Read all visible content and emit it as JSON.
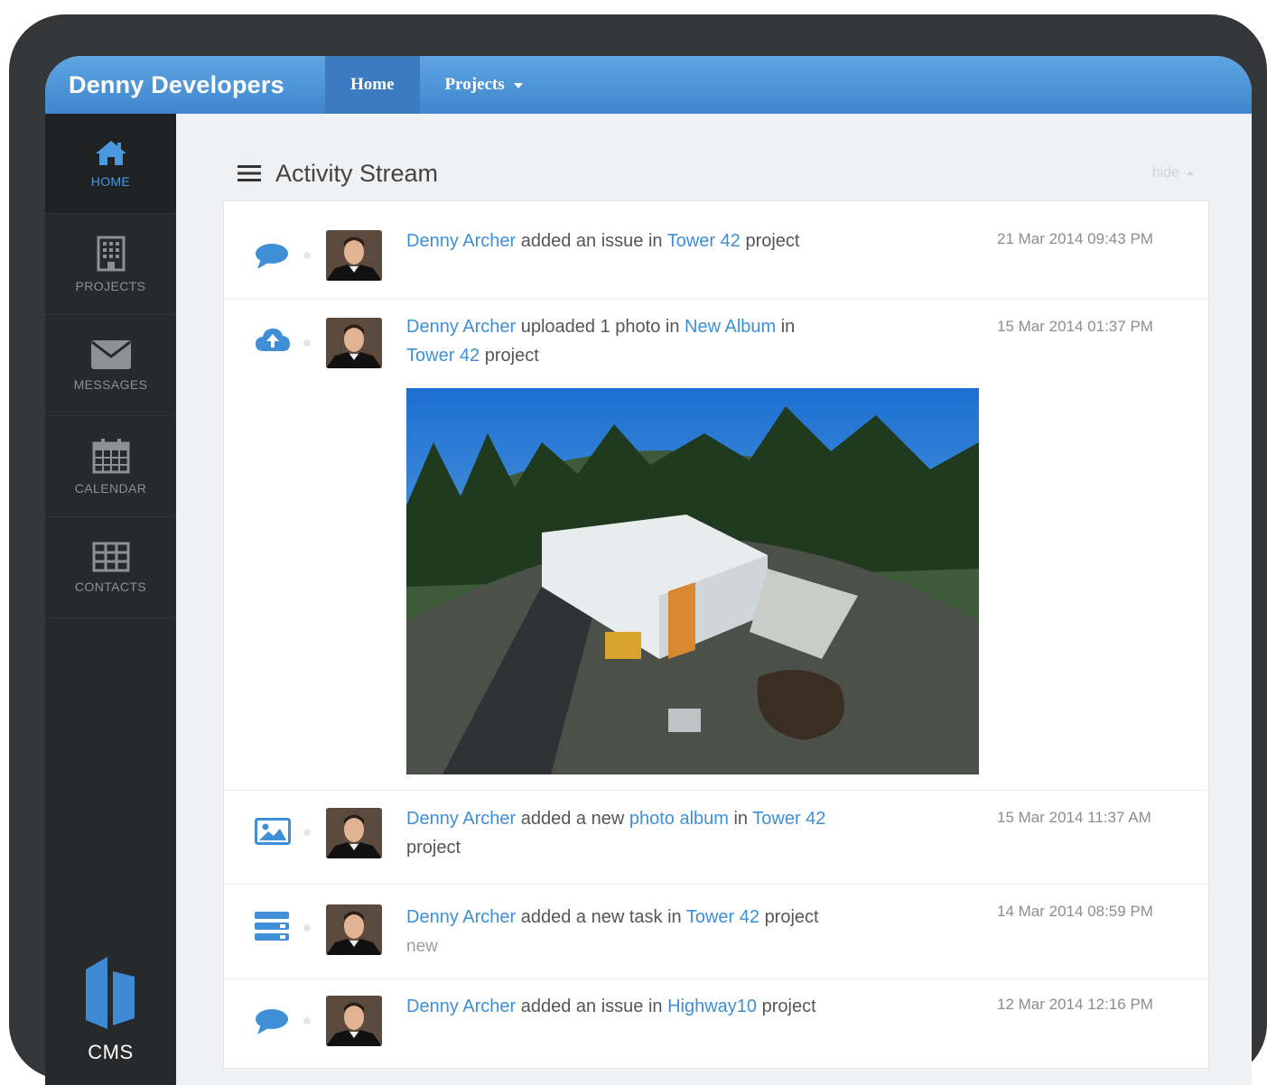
{
  "brand": "Denny Developers",
  "nav": {
    "home": "Home",
    "projects": "Projects"
  },
  "sidebar": {
    "items": [
      {
        "label": "HOME",
        "icon": "home-icon"
      },
      {
        "label": "PROJECTS",
        "icon": "building-icon"
      },
      {
        "label": "MESSAGES",
        "icon": "envelope-icon"
      },
      {
        "label": "CALENDAR",
        "icon": "calendar-icon"
      },
      {
        "label": "CONTACTS",
        "icon": "grid-icon"
      }
    ],
    "logo_label": "CMS"
  },
  "stream": {
    "title": "Activity Stream",
    "hide_label": "hide",
    "entries": [
      {
        "icon": "comment-icon",
        "user": "Denny Archer",
        "verb": "added an issue in",
        "target": "Tower 42",
        "suffix": "project",
        "time": "21 Mar 2014 09:43 PM"
      },
      {
        "icon": "cloud-upload-icon",
        "user": "Denny Archer",
        "verb": "uploaded 1 photo in",
        "target": "New Album",
        "mid": "in",
        "target2": "Tower 42",
        "suffix": "project",
        "time": "15 Mar 2014 01:37 PM"
      },
      {
        "icon": "picture-icon",
        "user": "Denny Archer",
        "verb": "added a new",
        "target": "photo album",
        "mid": "in",
        "target2": "Tower 42",
        "suffix": "project",
        "time": "15 Mar 2014 11:37 AM"
      },
      {
        "icon": "tasks-icon",
        "user": "Denny Archer",
        "verb": "added a new task in",
        "target": "Tower 42",
        "suffix": "project",
        "status": "new",
        "time": "14 Mar 2014 08:59 PM"
      },
      {
        "icon": "comment-icon",
        "user": "Denny Archer",
        "verb": "added an issue in",
        "target": "Highway10",
        "suffix": "project",
        "time": "12 Mar 2014 12:16 PM"
      }
    ]
  },
  "colors": {
    "accent": "#3e8fd6",
    "topbar": "#4a92d8",
    "sidebar": "#27292b"
  }
}
